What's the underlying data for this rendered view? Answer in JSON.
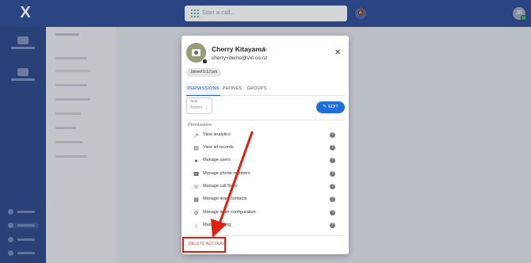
{
  "topbar": {
    "logo": "X",
    "call_placeholder": "Start a call...",
    "bell_icon": "bell-icon",
    "avatar_initials": "JR"
  },
  "dialog": {
    "name": "Cherry Kitayama",
    "email": "cherry+demo@vxt.co.nz",
    "joined": "Joined 5:12 pm",
    "tabs": [
      "PERMISSIONS",
      "PHONES",
      "GROUPS"
    ],
    "role_label": "Role",
    "role_value": "Admin",
    "edit_label": "EDIT",
    "permissions_title": "Permissions",
    "permissions": [
      {
        "label": "View analytics",
        "icon": "trend-icon"
      },
      {
        "label": "View all records",
        "icon": "folder-icon"
      },
      {
        "label": "Manage users",
        "icon": "users-icon"
      },
      {
        "label": "Manage phone numbers",
        "icon": "phone-icon"
      },
      {
        "label": "Manage call flows",
        "icon": "call-flow-icon"
      },
      {
        "label": "Manage team contacts",
        "icon": "contacts-icon"
      },
      {
        "label": "Manage team configuration",
        "icon": "gear-icon"
      },
      {
        "label": "Manage billing",
        "icon": "bank-icon"
      }
    ],
    "delete_label": "DELETE ACCOUNT"
  },
  "colors": {
    "topbar": "#2f4f97",
    "sidebar": "#2e4a88",
    "accent": "#1e6fd9",
    "danger": "#d83a2c",
    "annotation": "#e11f12"
  }
}
